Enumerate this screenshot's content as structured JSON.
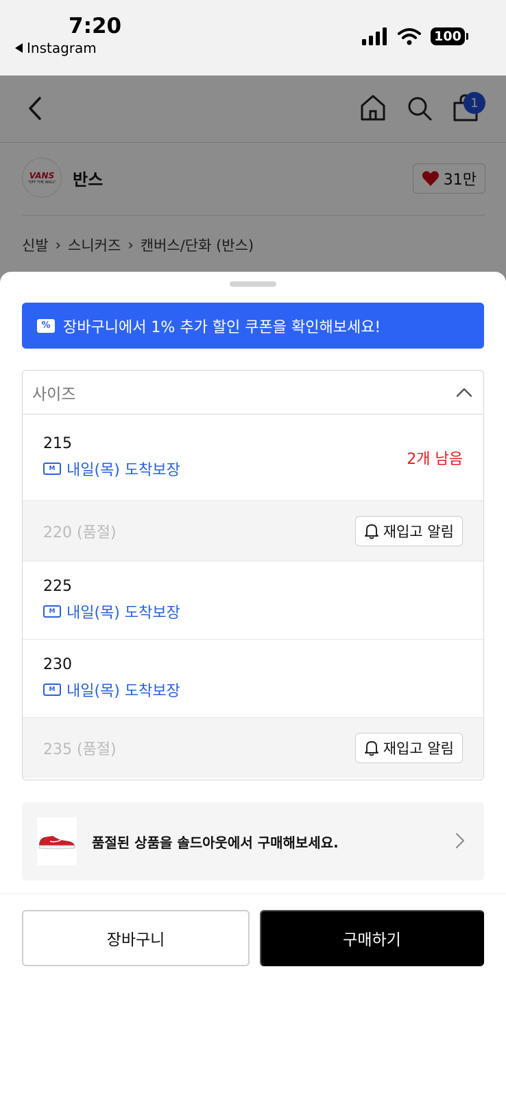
{
  "status_bar": {
    "time": "7:20",
    "back_app": "Instagram",
    "battery": "100"
  },
  "header": {
    "cart_count": "1"
  },
  "brand": {
    "logo_text": "VANS",
    "logo_subtext": "\"OFF THE WALL\"",
    "name": "반스",
    "likes": "31만"
  },
  "breadcrumb": [
    "신발",
    "스니커즈",
    "캔버스/단화 (반스)"
  ],
  "coupon_banner": {
    "text": "장바구니에서 1% 추가 할인 쿠폰을 확인해보세요!"
  },
  "size_selector": {
    "placeholder": "사이즈",
    "options": [
      {
        "size": "215",
        "delivery": "내일(목) 도착보장",
        "stock": "2개 남음"
      },
      {
        "label": "220 (품절)",
        "restock": "재입고 알림"
      },
      {
        "size": "225",
        "delivery": "내일(목) 도착보장"
      },
      {
        "size": "230",
        "delivery": "내일(목) 도착보장"
      },
      {
        "label": "235 (품절)",
        "restock": "재입고 알림"
      }
    ]
  },
  "soldout_banner": {
    "text": "품절된 상품을 솔드아웃에서 구매해보세요."
  },
  "actions": {
    "cart": "장바구니",
    "buy": "구매하기"
  },
  "colors": {
    "accent_blue": "#2d63f5",
    "delivery_blue": "#2962d9",
    "stock_red": "#e02020",
    "badge_blue": "#1f4fd8"
  }
}
